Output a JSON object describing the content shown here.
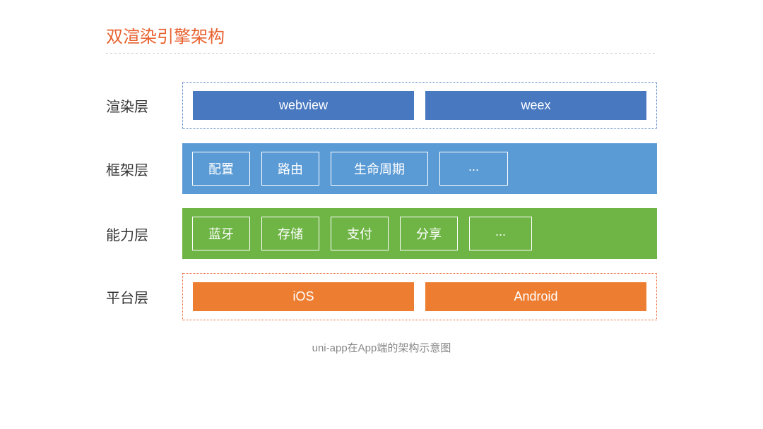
{
  "title": "双渲染引擎架构",
  "layers": {
    "render": {
      "label": "渲染层",
      "items": [
        "webview",
        "weex"
      ]
    },
    "framework": {
      "label": "框架层",
      "items": [
        "配置",
        "路由",
        "生命周期",
        "..."
      ]
    },
    "capability": {
      "label": "能力层",
      "items": [
        "蓝牙",
        "存储",
        "支付",
        "分享",
        "..."
      ]
    },
    "platform": {
      "label": "平台层",
      "items": [
        "iOS",
        "Android"
      ]
    }
  },
  "caption": "uni-app在App端的架构示意图"
}
